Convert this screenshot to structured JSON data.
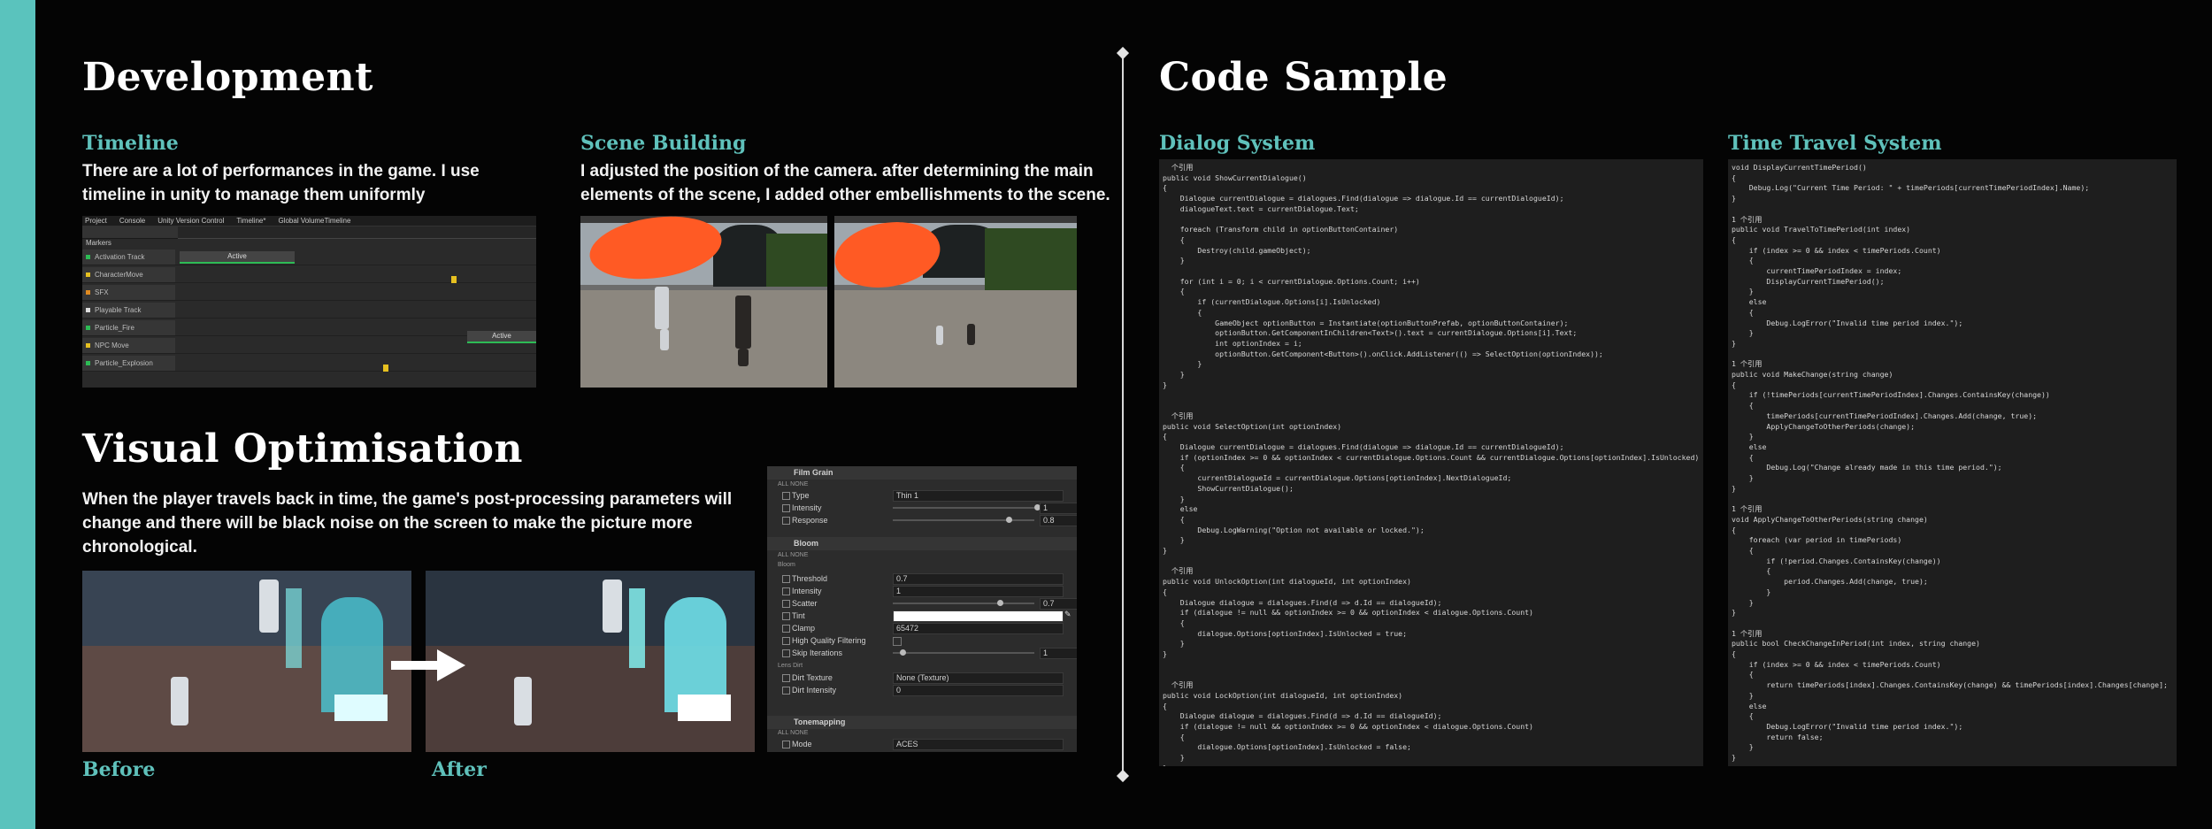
{
  "colors": {
    "accent": "#5ac3bd",
    "background": "#040404",
    "heading": "#ffffff",
    "subheading": "#5fc1bb"
  },
  "development": {
    "title": "Development",
    "timeline": {
      "title": "Timeline",
      "description_line1": "There are a lot of performances in the game. I use",
      "description_line2": "timeline in unity to manage them uniformly",
      "tabs": [
        "Project",
        "Console",
        "Unity Version Control",
        "Timeline*"
      ],
      "global_label": "Global VolumeTimeline",
      "markers_label": "Markers",
      "tracks": [
        "Activation Track",
        "CharacterMove",
        "SFX",
        "Playable Track",
        "Particle_Fire",
        "NPC Move",
        "Particle_Explosion"
      ],
      "clip_labels": [
        "Active",
        "Active"
      ]
    },
    "scene": {
      "title": "Scene Building",
      "description_line1": "I adjusted the position of the camera. after determining the main",
      "description_line2": "elements of the scene, I added other embellishments to the scene."
    }
  },
  "visual": {
    "title": "Visual Optimisation",
    "description_line1": "When the player travels back in time, the game's post-processing parameters will",
    "description_line2": "change and there will be black noise on the screen to make the picture more",
    "description_line3": "chronological.",
    "before_label": "Before",
    "after_label": "After",
    "inspector": {
      "film_grain": "Film Grain",
      "all_none": "ALL  NONE",
      "type_label": "Type",
      "type_value": "Thin 1",
      "intensity_label": "Intensity",
      "intensity_value": "1",
      "response_label": "Response",
      "response_value": "0.8",
      "bloom": "Bloom",
      "bloom_sub": "Bloom",
      "threshold_label": "Threshold",
      "threshold_value": "0.7",
      "bintensity_label": "Intensity",
      "bintensity_value": "1",
      "scatter_label": "Scatter",
      "scatter_value": "0.7",
      "tint_label": "Tint",
      "clamp_label": "Clamp",
      "clamp_value": "65472",
      "hq_label": "High Quality Filtering",
      "skip_label": "Skip Iterations",
      "skip_value": "1",
      "lens_dirt": "Lens Dirt",
      "dirt_texture_label": "Dirt Texture",
      "dirt_texture_value": "None (Texture)",
      "dirt_intensity_label": "Dirt Intensity",
      "dirt_intensity_value": "0",
      "tonemapping": "Tonemapping",
      "mode_label": "Mode",
      "mode_value": "ACES"
    }
  },
  "code_sample": {
    "title": "Code Sample",
    "dialog": {
      "title": "Dialog System",
      "code": "  个引用\npublic void ShowCurrentDialogue()\n{\n    Dialogue currentDialogue = dialogues.Find(dialogue => dialogue.Id == currentDialogueId);\n    dialogueText.text = currentDialogue.Text;\n\n    foreach (Transform child in optionButtonContainer)\n    {\n        Destroy(child.gameObject);\n    }\n\n    for (int i = 0; i < currentDialogue.Options.Count; i++)\n    {\n        if (currentDialogue.Options[i].IsUnlocked)\n        {\n            GameObject optionButton = Instantiate(optionButtonPrefab, optionButtonContainer);\n            optionButton.GetComponentInChildren<Text>().text = currentDialogue.Options[i].Text;\n            int optionIndex = i;\n            optionButton.GetComponent<Button>().onClick.AddListener(() => SelectOption(optionIndex));\n        }\n    }\n}\n\n\n  个引用\npublic void SelectOption(int optionIndex)\n{\n    Dialogue currentDialogue = dialogues.Find(dialogue => dialogue.Id == currentDialogueId);\n    if (optionIndex >= 0 && optionIndex < currentDialogue.Options.Count && currentDialogue.Options[optionIndex].IsUnlocked)\n    {\n        currentDialogueId = currentDialogue.Options[optionIndex].NextDialogueId;\n        ShowCurrentDialogue();\n    }\n    else\n    {\n        Debug.LogWarning(\"Option not available or locked.\");\n    }\n}\n\n  个引用\npublic void UnlockOption(int dialogueId, int optionIndex)\n{\n    Dialogue dialogue = dialogues.Find(d => d.Id == dialogueId);\n    if (dialogue != null && optionIndex >= 0 && optionIndex < dialogue.Options.Count)\n    {\n        dialogue.Options[optionIndex].IsUnlocked = true;\n    }\n}\n\n\n  个引用\npublic void LockOption(int dialogueId, int optionIndex)\n{\n    Dialogue dialogue = dialogues.Find(d => d.Id == dialogueId);\n    if (dialogue != null && optionIndex >= 0 && optionIndex < dialogue.Options.Count)\n    {\n        dialogue.Options[optionIndex].IsUnlocked = false;\n    }\n}"
    },
    "time_travel": {
      "title": "Time Travel System",
      "code": "void DisplayCurrentTimePeriod()\n{\n    Debug.Log(\"Current Time Period: \" + timePeriods[currentTimePeriodIndex].Name);\n}\n\n1 个引用\npublic void TravelToTimePeriod(int index)\n{\n    if (index >= 0 && index < timePeriods.Count)\n    {\n        currentTimePeriodIndex = index;\n        DisplayCurrentTimePeriod();\n    }\n    else\n    {\n        Debug.LogError(\"Invalid time period index.\");\n    }\n}\n\n1 个引用\npublic void MakeChange(string change)\n{\n    if (!timePeriods[currentTimePeriodIndex].Changes.ContainsKey(change))\n    {\n        timePeriods[currentTimePeriodIndex].Changes.Add(change, true);\n        ApplyChangeToOtherPeriods(change);\n    }\n    else\n    {\n        Debug.Log(\"Change already made in this time period.\");\n    }\n}\n\n1 个引用\nvoid ApplyChangeToOtherPeriods(string change)\n{\n    foreach (var period in timePeriods)\n    {\n        if (!period.Changes.ContainsKey(change))\n        {\n            period.Changes.Add(change, true);\n        }\n    }\n}\n\n1 个引用\npublic bool CheckChangeInPeriod(int index, string change)\n{\n    if (index >= 0 && index < timePeriods.Count)\n    {\n        return timePeriods[index].Changes.ContainsKey(change) && timePeriods[index].Changes[change];\n    }\n    else\n    {\n        Debug.LogError(\"Invalid time period index.\");\n        return false;\n    }\n}"
    }
  }
}
